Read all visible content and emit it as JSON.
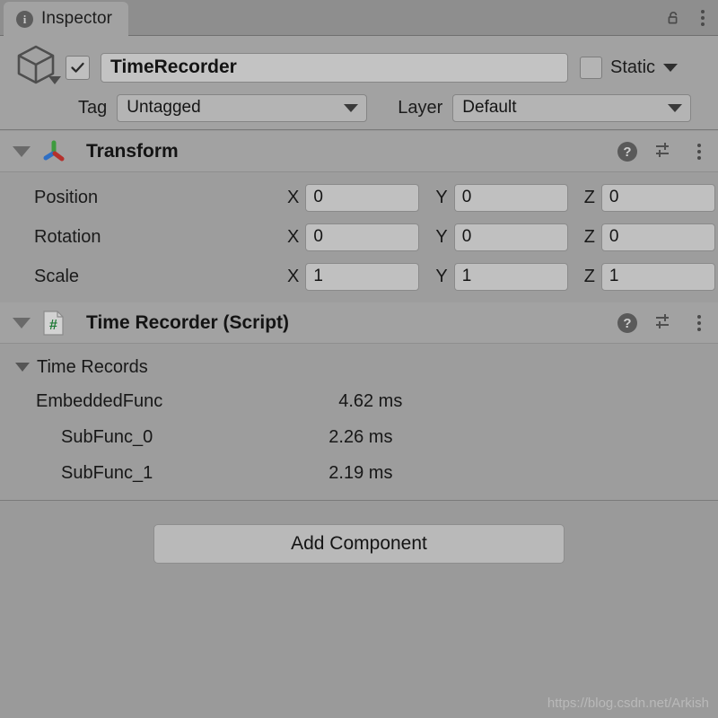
{
  "window": {
    "tab_label": "Inspector",
    "tab_icon": "info-icon",
    "lock_icon": "unlocked-padlock-icon",
    "menu_icon": "kebab-menu-icon"
  },
  "gameobject": {
    "icon": "cube-icon",
    "enabled_checkbox": true,
    "name": "TimeRecorder",
    "name_placeholder": "Name",
    "static_label": "Static",
    "static_checked": false,
    "tag_label": "Tag",
    "tag_value": "Untagged",
    "layer_label": "Layer",
    "layer_value": "Default"
  },
  "components": [
    {
      "id": "transform",
      "title": "Transform",
      "icon": "transform-axis-icon",
      "expanded": true,
      "help_icon": "help-icon",
      "preset_icon": "preset-sliders-icon",
      "menu_icon": "kebab-menu-icon",
      "rows": [
        {
          "label": "Position",
          "axes": [
            "X",
            "Y",
            "Z"
          ],
          "values": [
            "0",
            "0",
            "0"
          ]
        },
        {
          "label": "Rotation",
          "axes": [
            "X",
            "Y",
            "Z"
          ],
          "values": [
            "0",
            "0",
            "0"
          ]
        },
        {
          "label": "Scale",
          "axes": [
            "X",
            "Y",
            "Z"
          ],
          "values": [
            "1",
            "1",
            "1"
          ]
        }
      ]
    },
    {
      "id": "time-recorder",
      "title": "Time Recorder (Script)",
      "icon": "csharp-script-icon",
      "icon_glyph": "#",
      "expanded": true,
      "help_icon": "help-icon",
      "preset_icon": "preset-sliders-icon",
      "menu_icon": "kebab-menu-icon",
      "records_label": "Time Records",
      "records_expanded": true,
      "records": [
        {
          "name": "EmbeddedFunc",
          "value": "4.62 ms",
          "depth": 0
        },
        {
          "name": "SubFunc_0",
          "value": "2.26 ms",
          "depth": 1
        },
        {
          "name": "SubFunc_1",
          "value": "2.19 ms",
          "depth": 1
        }
      ]
    }
  ],
  "add_component_label": "Add Component",
  "watermark": "https://blog.csdn.net/Arkish",
  "colors": {
    "panel_bg": "#a2a2a2",
    "body_bg": "#9d9d9d",
    "page_bg": "#9a9a9a",
    "toolbar_bg": "#8e8e8e",
    "field_bg": "#c0c0c0",
    "axis_green": "#3e9b3e",
    "axis_red": "#b5312c",
    "axis_blue": "#2f6fc4",
    "script_green": "#1f7a35"
  }
}
